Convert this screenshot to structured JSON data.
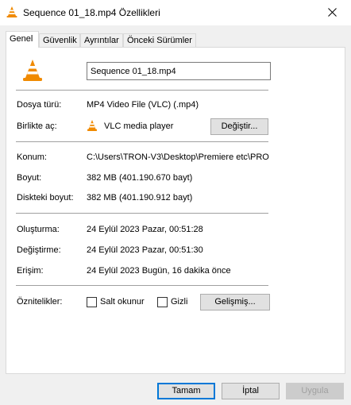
{
  "window": {
    "title": "Sequence 01_18.mp4 Özellikleri",
    "icon": "vlc-cone-icon"
  },
  "tabs": [
    {
      "label": "Genel",
      "active": true
    },
    {
      "label": "Güvenlik",
      "active": false
    },
    {
      "label": "Ayrıntılar",
      "active": false
    },
    {
      "label": "Önceki Sürümler",
      "active": false
    }
  ],
  "general": {
    "file_name": "Sequence 01_18.mp4",
    "file_type": {
      "label": "Dosya türü:",
      "value": "MP4 Video File (VLC) (.mp4)"
    },
    "opens_with": {
      "label": "Birlikte aç:",
      "value": "VLC media player",
      "change_button": "Değiştir..."
    },
    "location": {
      "label": "Konum:",
      "value": "C:\\Users\\TRON-V3\\Desktop\\Premiere etc\\PRO"
    },
    "size": {
      "label": "Boyut:",
      "value": "382 MB (401.190.670 bayt)"
    },
    "size_on_disk": {
      "label": "Diskteki boyut:",
      "value": "382 MB (401.190.912 bayt)"
    },
    "created": {
      "label": "Oluşturma:",
      "value": "24 Eylül 2023 Pazar, 00:51:28"
    },
    "modified": {
      "label": "Değiştirme:",
      "value": "24 Eylül 2023 Pazar, 00:51:30"
    },
    "accessed": {
      "label": "Erişim:",
      "value": "24 Eylül 2023 Bugün, 16 dakika önce"
    },
    "attributes": {
      "label": "Öznitelikler:",
      "read_only": {
        "label": "Salt okunur",
        "checked": false
      },
      "hidden": {
        "label": "Gizli",
        "checked": false
      },
      "advanced_button": "Gelişmiş..."
    }
  },
  "footer": {
    "ok": "Tamam",
    "cancel": "İptal",
    "apply": "Uygula"
  },
  "colors": {
    "vlc_orange": "#f08a00",
    "accent": "#0078d7"
  }
}
